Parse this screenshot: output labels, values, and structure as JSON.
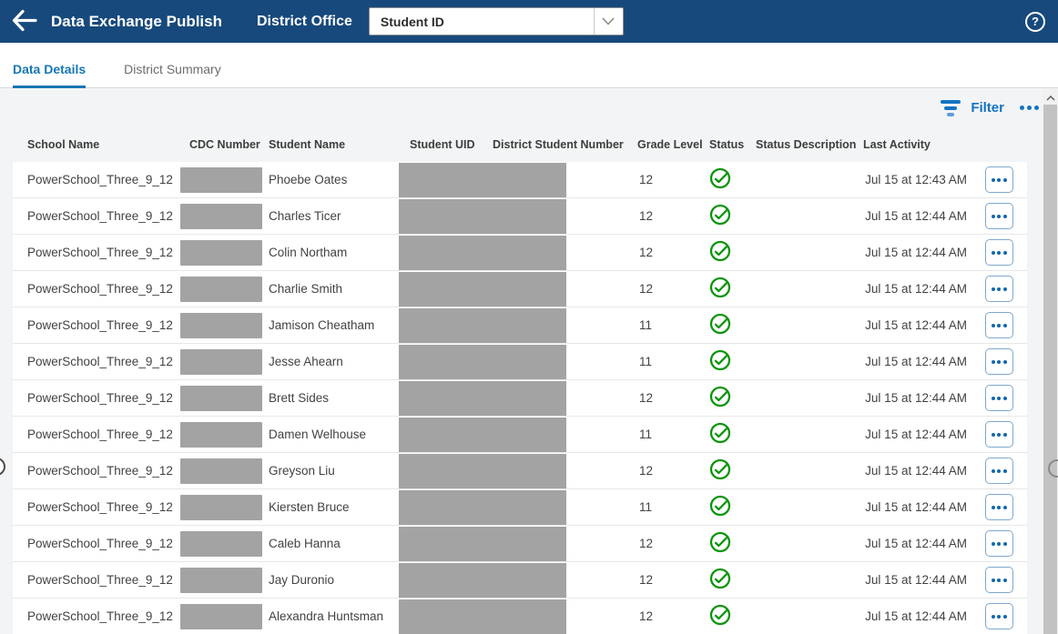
{
  "header": {
    "title": "Data Exchange Publish",
    "context": "District Office",
    "dropdown": {
      "value": "Student ID"
    },
    "help_label": "?"
  },
  "tabs": [
    {
      "label": "Data Details",
      "active": true
    },
    {
      "label": "District Summary",
      "active": false
    }
  ],
  "toolbar": {
    "filter_label": "Filter"
  },
  "table": {
    "columns": {
      "school": "School Name",
      "cdc": "CDC Number",
      "student": "Student Name",
      "uid": "Student UID",
      "district_number": "District Student Number",
      "grade": "Grade Level",
      "status": "Status",
      "status_description": "Status Description",
      "last_activity": "Last Activity"
    },
    "rows": [
      {
        "school": "PowerSchool_Three_9_12",
        "student": "Phoebe Oates",
        "grade": "12",
        "status": "success",
        "status_description": "",
        "last_activity": "Jul 15 at 12:43 AM"
      },
      {
        "school": "PowerSchool_Three_9_12",
        "student": "Charles Ticer",
        "grade": "12",
        "status": "success",
        "status_description": "",
        "last_activity": "Jul 15 at 12:44 AM"
      },
      {
        "school": "PowerSchool_Three_9_12",
        "student": "Colin Northam",
        "grade": "12",
        "status": "success",
        "status_description": "",
        "last_activity": "Jul 15 at 12:44 AM"
      },
      {
        "school": "PowerSchool_Three_9_12",
        "student": "Charlie Smith",
        "grade": "12",
        "status": "success",
        "status_description": "",
        "last_activity": "Jul 15 at 12:44 AM"
      },
      {
        "school": "PowerSchool_Three_9_12",
        "student": "Jamison Cheatham",
        "grade": "11",
        "status": "success",
        "status_description": "",
        "last_activity": "Jul 15 at 12:44 AM"
      },
      {
        "school": "PowerSchool_Three_9_12",
        "student": "Jesse Ahearn",
        "grade": "11",
        "status": "success",
        "status_description": "",
        "last_activity": "Jul 15 at 12:44 AM"
      },
      {
        "school": "PowerSchool_Three_9_12",
        "student": "Brett Sides",
        "grade": "12",
        "status": "success",
        "status_description": "",
        "last_activity": "Jul 15 at 12:44 AM"
      },
      {
        "school": "PowerSchool_Three_9_12",
        "student": "Damen Welhouse",
        "grade": "11",
        "status": "success",
        "status_description": "",
        "last_activity": "Jul 15 at 12:44 AM"
      },
      {
        "school": "PowerSchool_Three_9_12",
        "student": "Greyson Liu",
        "grade": "12",
        "status": "success",
        "status_description": "",
        "last_activity": "Jul 15 at 12:44 AM"
      },
      {
        "school": "PowerSchool_Three_9_12",
        "student": "Kiersten Bruce",
        "grade": "11",
        "status": "success",
        "status_description": "",
        "last_activity": "Jul 15 at 12:44 AM"
      },
      {
        "school": "PowerSchool_Three_9_12",
        "student": "Caleb Hanna",
        "grade": "12",
        "status": "success",
        "status_description": "",
        "last_activity": "Jul 15 at 12:44 AM"
      },
      {
        "school": "PowerSchool_Three_9_12",
        "student": "Jay Duronio",
        "grade": "12",
        "status": "success",
        "status_description": "",
        "last_activity": "Jul 15 at 12:44 AM"
      },
      {
        "school": "PowerSchool_Three_9_12",
        "student": "Alexandra Huntsman",
        "grade": "12",
        "status": "success",
        "status_description": "",
        "last_activity": "Jul 15 at 12:44 AM"
      }
    ]
  },
  "colors": {
    "header_bg": "#17497c",
    "accent_blue": "#1373c4",
    "tab_active_blue": "#1577b4",
    "success_green": "#0b940b",
    "redaction_gray": "#a3a3a3"
  }
}
